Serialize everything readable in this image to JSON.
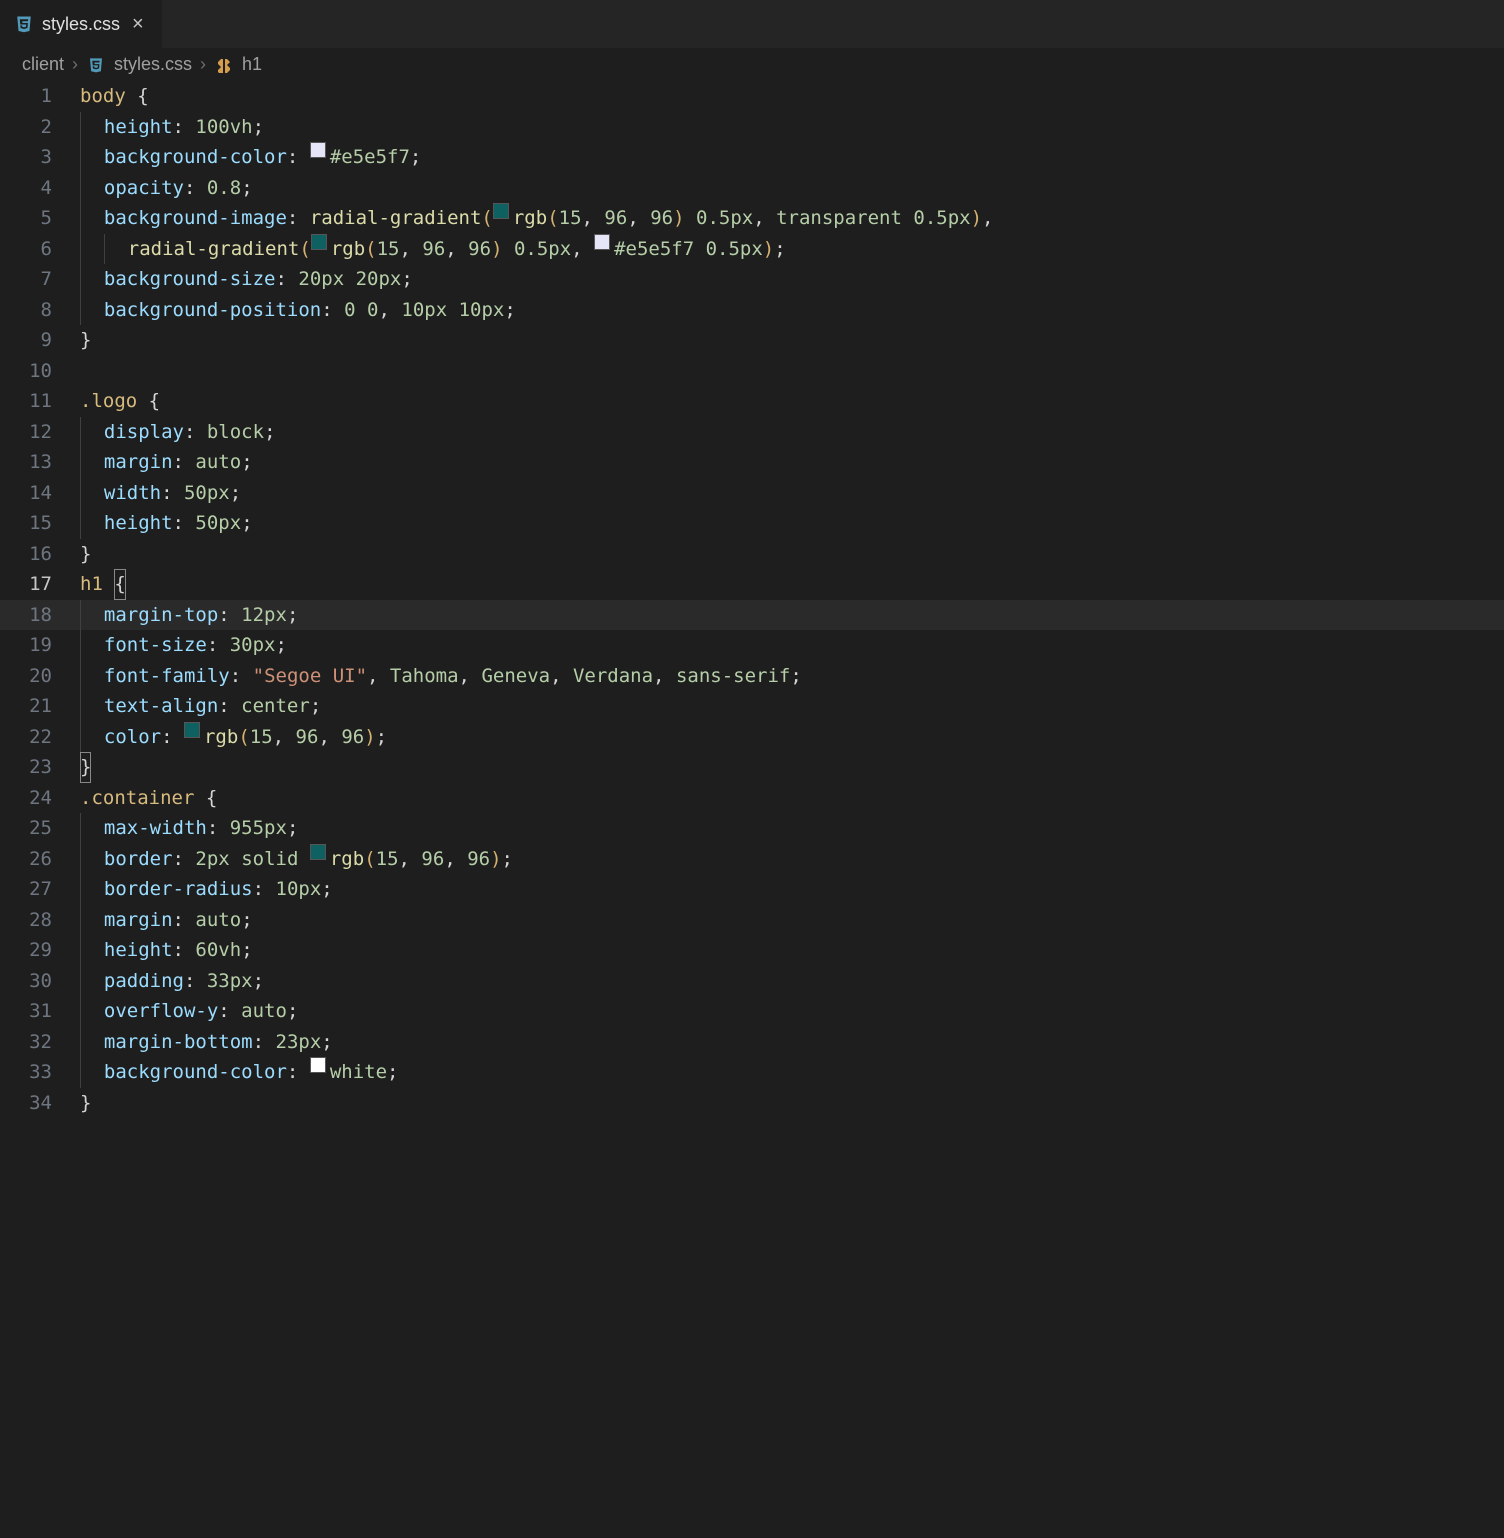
{
  "tab": {
    "filename": "styles.css",
    "icon": "css-file-icon",
    "close": "×"
  },
  "breadcrumbs": {
    "parts": [
      "client",
      "styles.css",
      "h1"
    ],
    "sep": "›"
  },
  "lines": [
    {
      "n": "1",
      "tokens": [
        [
          "sel",
          "body "
        ],
        [
          "punct",
          "{"
        ]
      ]
    },
    {
      "n": "2",
      "tokens": [
        [
          "indent",
          1
        ],
        [
          "prop",
          "height"
        ],
        [
          "punct",
          ": "
        ],
        [
          "num",
          "100vh"
        ],
        [
          "punct",
          ";"
        ]
      ]
    },
    {
      "n": "3",
      "tokens": [
        [
          "indent",
          1
        ],
        [
          "prop",
          "background-color"
        ],
        [
          "punct",
          ": "
        ],
        [
          "swatch",
          "#e5e5f7"
        ],
        [
          "num",
          "#e5e5f7"
        ],
        [
          "punct",
          ";"
        ]
      ]
    },
    {
      "n": "4",
      "tokens": [
        [
          "indent",
          1
        ],
        [
          "prop",
          "opacity"
        ],
        [
          "punct",
          ": "
        ],
        [
          "num",
          "0.8"
        ],
        [
          "punct",
          ";"
        ]
      ]
    },
    {
      "n": "5",
      "tokens": [
        [
          "indent",
          1
        ],
        [
          "prop",
          "background-image"
        ],
        [
          "punct",
          ": "
        ],
        [
          "func",
          "radial-gradient"
        ],
        [
          "paren",
          "("
        ],
        [
          "swatch",
          "rgb(15,96,96)"
        ],
        [
          "func",
          "rgb"
        ],
        [
          "paren",
          "("
        ],
        [
          "num",
          "15"
        ],
        [
          "punct",
          ", "
        ],
        [
          "num",
          "96"
        ],
        [
          "punct",
          ", "
        ],
        [
          "num",
          "96"
        ],
        [
          "paren",
          ")"
        ],
        [
          "punct",
          " "
        ],
        [
          "num",
          "0.5px"
        ],
        [
          "punct",
          ", "
        ],
        [
          "num",
          "transparent"
        ],
        [
          "punct",
          " "
        ],
        [
          "num",
          "0.5px"
        ],
        [
          "paren",
          ")"
        ],
        [
          "punct",
          ","
        ]
      ]
    },
    {
      "n": "6",
      "tokens": [
        [
          "indent",
          2
        ],
        [
          "func",
          "radial-gradient"
        ],
        [
          "paren",
          "("
        ],
        [
          "swatch",
          "rgb(15,96,96)"
        ],
        [
          "func",
          "rgb"
        ],
        [
          "paren",
          "("
        ],
        [
          "num",
          "15"
        ],
        [
          "punct",
          ", "
        ],
        [
          "num",
          "96"
        ],
        [
          "punct",
          ", "
        ],
        [
          "num",
          "96"
        ],
        [
          "paren",
          ")"
        ],
        [
          "punct",
          " "
        ],
        [
          "num",
          "0.5px"
        ],
        [
          "punct",
          ", "
        ],
        [
          "swatch",
          "#e5e5f7"
        ],
        [
          "num",
          "#e5e5f7"
        ],
        [
          "punct",
          " "
        ],
        [
          "num",
          "0.5px"
        ],
        [
          "paren",
          ")"
        ],
        [
          "punct",
          ";"
        ]
      ]
    },
    {
      "n": "7",
      "tokens": [
        [
          "indent",
          1
        ],
        [
          "prop",
          "background-size"
        ],
        [
          "punct",
          ": "
        ],
        [
          "num",
          "20px"
        ],
        [
          "punct",
          " "
        ],
        [
          "num",
          "20px"
        ],
        [
          "punct",
          ";"
        ]
      ]
    },
    {
      "n": "8",
      "tokens": [
        [
          "indent",
          1
        ],
        [
          "prop",
          "background-position"
        ],
        [
          "punct",
          ": "
        ],
        [
          "num",
          "0"
        ],
        [
          "punct",
          " "
        ],
        [
          "num",
          "0"
        ],
        [
          "punct",
          ", "
        ],
        [
          "num",
          "10px"
        ],
        [
          "punct",
          " "
        ],
        [
          "num",
          "10px"
        ],
        [
          "punct",
          ";"
        ]
      ]
    },
    {
      "n": "9",
      "tokens": [
        [
          "punct",
          "}"
        ]
      ]
    },
    {
      "n": "10",
      "tokens": []
    },
    {
      "n": "11",
      "tokens": [
        [
          "sel",
          ".logo "
        ],
        [
          "punct",
          "{"
        ]
      ]
    },
    {
      "n": "12",
      "tokens": [
        [
          "indent",
          1
        ],
        [
          "prop",
          "display"
        ],
        [
          "punct",
          ": "
        ],
        [
          "num",
          "block"
        ],
        [
          "punct",
          ";"
        ]
      ]
    },
    {
      "n": "13",
      "tokens": [
        [
          "indent",
          1
        ],
        [
          "prop",
          "margin"
        ],
        [
          "punct",
          ": "
        ],
        [
          "num",
          "auto"
        ],
        [
          "punct",
          ";"
        ]
      ]
    },
    {
      "n": "14",
      "tokens": [
        [
          "indent",
          1
        ],
        [
          "prop",
          "width"
        ],
        [
          "punct",
          ": "
        ],
        [
          "num",
          "50px"
        ],
        [
          "punct",
          ";"
        ]
      ]
    },
    {
      "n": "15",
      "tokens": [
        [
          "indent",
          1
        ],
        [
          "prop",
          "height"
        ],
        [
          "punct",
          ": "
        ],
        [
          "num",
          "50px"
        ],
        [
          "punct",
          ";"
        ]
      ]
    },
    {
      "n": "16",
      "tokens": [
        [
          "punct",
          "}"
        ]
      ]
    },
    {
      "n": "17",
      "tokens": [
        [
          "sel",
          "h1 "
        ],
        [
          "punct-hl",
          "{"
        ]
      ],
      "active": true
    },
    {
      "n": "18",
      "tokens": [
        [
          "indent",
          1
        ],
        [
          "prop",
          "margin-top"
        ],
        [
          "punct",
          ": "
        ],
        [
          "num",
          "12px"
        ],
        [
          "punct",
          ";"
        ]
      ],
      "current": true
    },
    {
      "n": "19",
      "tokens": [
        [
          "indent",
          1
        ],
        [
          "prop",
          "font-size"
        ],
        [
          "punct",
          ": "
        ],
        [
          "num",
          "30px"
        ],
        [
          "punct",
          ";"
        ]
      ]
    },
    {
      "n": "20",
      "tokens": [
        [
          "indent",
          1
        ],
        [
          "prop",
          "font-family"
        ],
        [
          "punct",
          ": "
        ],
        [
          "str",
          "\"Segoe UI\""
        ],
        [
          "punct",
          ", "
        ],
        [
          "num",
          "Tahoma"
        ],
        [
          "punct",
          ", "
        ],
        [
          "num",
          "Geneva"
        ],
        [
          "punct",
          ", "
        ],
        [
          "num",
          "Verdana"
        ],
        [
          "punct",
          ", "
        ],
        [
          "num",
          "sans-serif"
        ],
        [
          "punct",
          ";"
        ]
      ]
    },
    {
      "n": "21",
      "tokens": [
        [
          "indent",
          1
        ],
        [
          "prop",
          "text-align"
        ],
        [
          "punct",
          ": "
        ],
        [
          "num",
          "center"
        ],
        [
          "punct",
          ";"
        ]
      ]
    },
    {
      "n": "22",
      "tokens": [
        [
          "indent",
          1
        ],
        [
          "prop",
          "color"
        ],
        [
          "punct",
          ": "
        ],
        [
          "swatch",
          "rgb(15,96,96)"
        ],
        [
          "func",
          "rgb"
        ],
        [
          "paren",
          "("
        ],
        [
          "num",
          "15"
        ],
        [
          "punct",
          ", "
        ],
        [
          "num",
          "96"
        ],
        [
          "punct",
          ", "
        ],
        [
          "num",
          "96"
        ],
        [
          "paren",
          ")"
        ],
        [
          "punct",
          ";"
        ]
      ]
    },
    {
      "n": "23",
      "tokens": [
        [
          "punct-hl",
          "}"
        ]
      ]
    },
    {
      "n": "24",
      "tokens": [
        [
          "sel",
          ".container "
        ],
        [
          "punct",
          "{"
        ]
      ]
    },
    {
      "n": "25",
      "tokens": [
        [
          "indent",
          1
        ],
        [
          "prop",
          "max-width"
        ],
        [
          "punct",
          ": "
        ],
        [
          "num",
          "955px"
        ],
        [
          "punct",
          ";"
        ]
      ]
    },
    {
      "n": "26",
      "tokens": [
        [
          "indent",
          1
        ],
        [
          "prop",
          "border"
        ],
        [
          "punct",
          ": "
        ],
        [
          "num",
          "2px"
        ],
        [
          "punct",
          " "
        ],
        [
          "num",
          "solid"
        ],
        [
          "punct",
          " "
        ],
        [
          "swatch",
          "rgb(15,96,96)"
        ],
        [
          "func",
          "rgb"
        ],
        [
          "paren",
          "("
        ],
        [
          "num",
          "15"
        ],
        [
          "punct",
          ", "
        ],
        [
          "num",
          "96"
        ],
        [
          "punct",
          ", "
        ],
        [
          "num",
          "96"
        ],
        [
          "paren",
          ")"
        ],
        [
          "punct",
          ";"
        ]
      ]
    },
    {
      "n": "27",
      "tokens": [
        [
          "indent",
          1
        ],
        [
          "prop",
          "border-radius"
        ],
        [
          "punct",
          ": "
        ],
        [
          "num",
          "10px"
        ],
        [
          "punct",
          ";"
        ]
      ]
    },
    {
      "n": "28",
      "tokens": [
        [
          "indent",
          1
        ],
        [
          "prop",
          "margin"
        ],
        [
          "punct",
          ": "
        ],
        [
          "num",
          "auto"
        ],
        [
          "punct",
          ";"
        ]
      ]
    },
    {
      "n": "29",
      "tokens": [
        [
          "indent",
          1
        ],
        [
          "prop",
          "height"
        ],
        [
          "punct",
          ": "
        ],
        [
          "num",
          "60vh"
        ],
        [
          "punct",
          ";"
        ]
      ]
    },
    {
      "n": "30",
      "tokens": [
        [
          "indent",
          1
        ],
        [
          "prop",
          "padding"
        ],
        [
          "punct",
          ": "
        ],
        [
          "num",
          "33px"
        ],
        [
          "punct",
          ";"
        ]
      ]
    },
    {
      "n": "31",
      "tokens": [
        [
          "indent",
          1
        ],
        [
          "prop",
          "overflow-y"
        ],
        [
          "punct",
          ": "
        ],
        [
          "num",
          "auto"
        ],
        [
          "punct",
          ";"
        ]
      ]
    },
    {
      "n": "32",
      "tokens": [
        [
          "indent",
          1
        ],
        [
          "prop",
          "margin-bottom"
        ],
        [
          "punct",
          ": "
        ],
        [
          "num",
          "23px"
        ],
        [
          "punct",
          ";"
        ]
      ]
    },
    {
      "n": "33",
      "tokens": [
        [
          "indent",
          1
        ],
        [
          "prop",
          "background-color"
        ],
        [
          "punct",
          ": "
        ],
        [
          "swatch",
          "white"
        ],
        [
          "num",
          "white"
        ],
        [
          "punct",
          ";"
        ]
      ]
    },
    {
      "n": "34",
      "tokens": [
        [
          "punct",
          "}"
        ]
      ]
    }
  ]
}
